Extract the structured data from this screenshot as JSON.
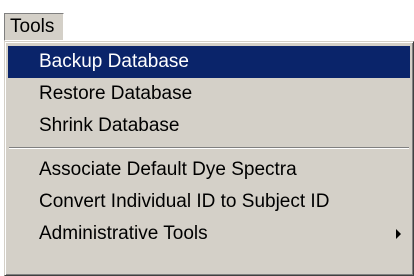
{
  "menubar": {
    "tools_label": "Tools"
  },
  "menu": {
    "items": [
      {
        "label": "Backup Database",
        "selected": true
      },
      {
        "label": "Restore Database"
      },
      {
        "label": "Shrink Database"
      },
      {
        "label": "Associate Default Dye Spectra"
      },
      {
        "label": "Convert Individual ID to Subject ID"
      },
      {
        "label": "Administrative Tools",
        "submenu_icon": "submenu-arrow-icon"
      }
    ]
  },
  "colors": {
    "menu_face": "#d4d0c8",
    "selection": "#0a246a",
    "selection_text": "#ffffff"
  }
}
